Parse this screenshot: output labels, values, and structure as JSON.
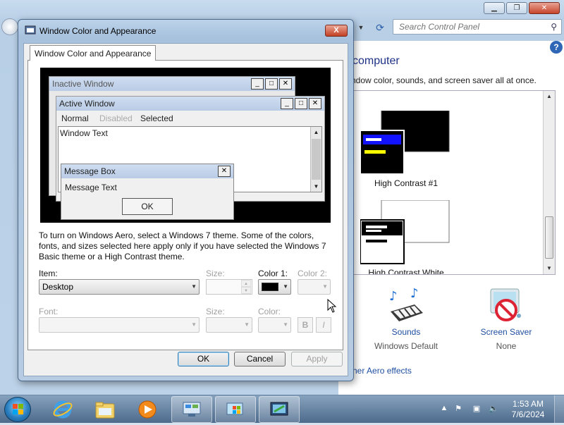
{
  "background": {
    "search_placeholder": "Search Control Panel",
    "heading": "computer",
    "description": "ndow color, sounds, and screen saver all at once.",
    "themes": [
      {
        "label": "High Contrast #1"
      },
      {
        "label": "High Contrast White"
      }
    ],
    "sounds": {
      "label": "Sounds",
      "sub": "Windows Default"
    },
    "screen_saver": {
      "label": "Screen Saver",
      "sub": "None"
    },
    "aero_link": "her Aero effects",
    "help_glyph": "?"
  },
  "dialog": {
    "title": "Window Color and Appearance",
    "tab": "Window Color and Appearance",
    "close_glyph": "X",
    "preview": {
      "inactive_title": "Inactive Window",
      "active_title": "Active Window",
      "menu_normal": "Normal",
      "menu_disabled": "Disabled",
      "menu_selected": "Selected",
      "window_text": "Window Text",
      "message_box_title": "Message Box",
      "message_text": "Message Text",
      "ok": "OK"
    },
    "info": "To turn on Windows Aero, select a Windows 7 theme.  Some of the colors, fonts, and sizes selected here apply only if you have selected the Windows 7 Basic theme or a High Contrast theme.",
    "item_label": "Item:",
    "item_value": "Desktop",
    "size_label": "Size:",
    "color1_label": "Color 1:",
    "color2_label": "Color 2:",
    "font_label": "Font:",
    "font_size_label": "Size:",
    "font_color_label": "Color:",
    "bold": "B",
    "italic": "I",
    "ok": "OK",
    "cancel": "Cancel",
    "apply": "Apply",
    "color1_value": "#000000"
  },
  "taskbar": {
    "time": "1:53 AM",
    "date": "7/6/2024"
  },
  "colors": {
    "link": "#1f4fa0",
    "title_bar": "#b9cce6",
    "disabled_text": "#a0a0a0"
  }
}
